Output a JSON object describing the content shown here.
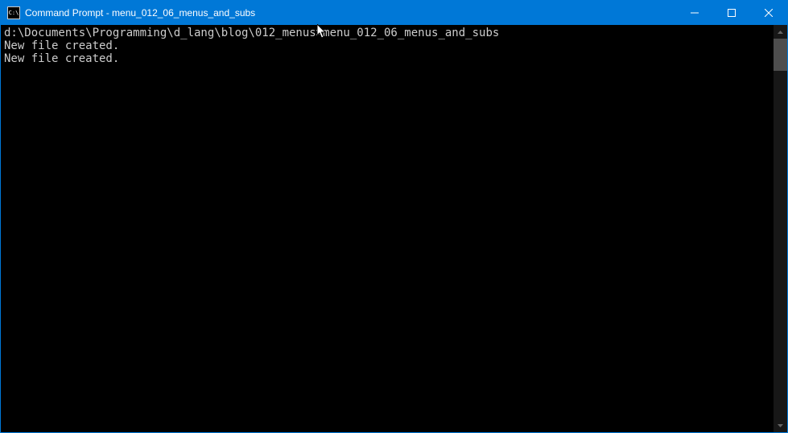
{
  "titlebar": {
    "icon_label": "C:\\",
    "title": "Command Prompt - menu_012_06_menus_and_subs"
  },
  "terminal": {
    "lines": [
      "",
      "d:\\Documents\\Programming\\d_lang\\blog\\012_menus>menu_012_06_menus_and_subs",
      "New file created.",
      "New file created."
    ]
  }
}
